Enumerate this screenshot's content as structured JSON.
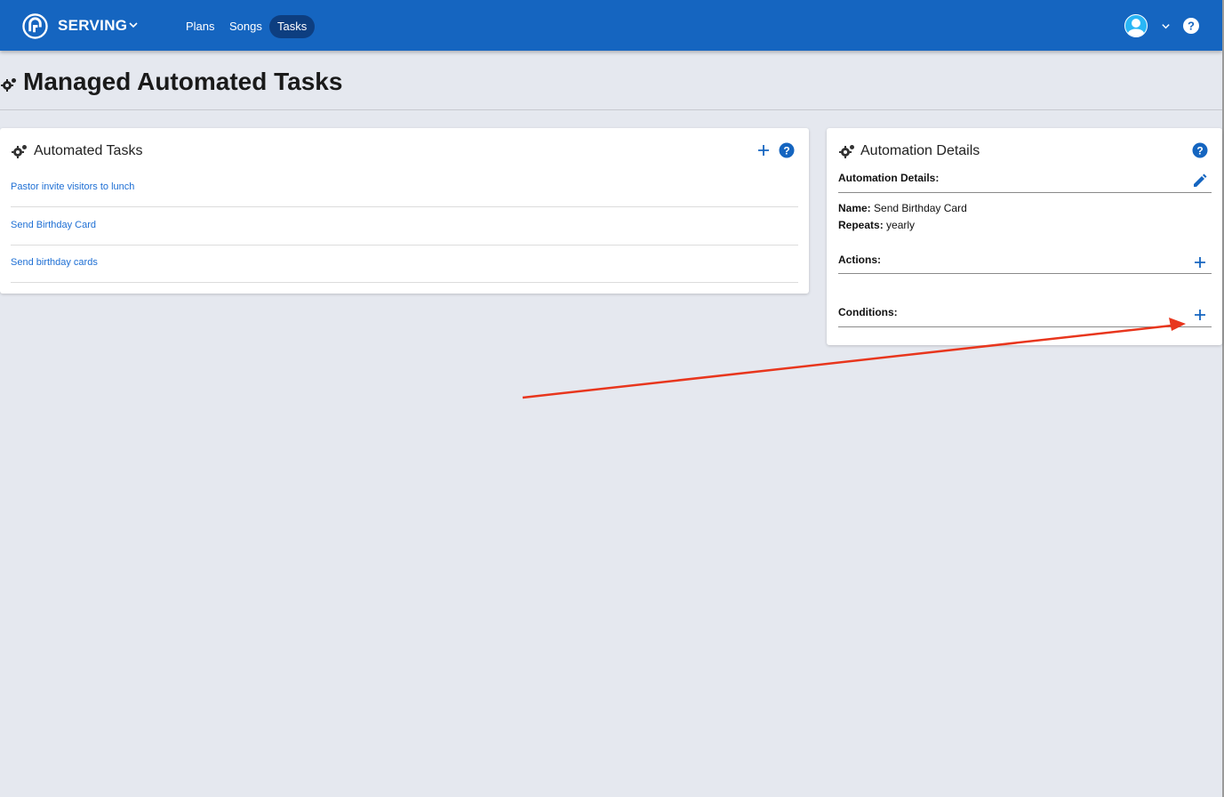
{
  "header": {
    "app_name": "SERVING",
    "nav": [
      {
        "label": "Plans"
      },
      {
        "label": "Songs"
      },
      {
        "label": "Tasks",
        "active": true
      }
    ],
    "brand_color": "#1565c0"
  },
  "page": {
    "title": "Managed Automated Tasks"
  },
  "tasks_card": {
    "title": "Automated Tasks",
    "items": [
      {
        "label": "Pastor invite visitors to lunch"
      },
      {
        "label": "Send Birthday Card"
      },
      {
        "label": "Send birthday cards"
      }
    ]
  },
  "details_card": {
    "title": "Automation Details",
    "section_label": "Automation Details:",
    "name_label": "Name:",
    "name_value": "Send Birthday Card",
    "repeats_label": "Repeats:",
    "repeats_value": "yearly",
    "actions_label": "Actions:",
    "conditions_label": "Conditions:"
  },
  "icons": {
    "logo": "serving-logo-icon",
    "gear": "gears-icon",
    "add": "plus-icon",
    "help": "help-circle-icon",
    "edit": "pencil-icon",
    "avatar": "user-avatar-icon",
    "chevron": "chevron-down-icon"
  },
  "annotation": {
    "type": "arrow",
    "color": "#e8361d",
    "points_to": "conditions-add-button"
  }
}
